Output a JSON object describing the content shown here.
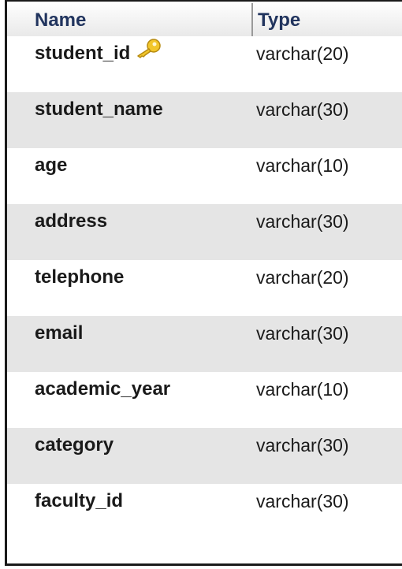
{
  "header": {
    "name_label": "Name",
    "type_label": "Type"
  },
  "rows": [
    {
      "name": "student_id",
      "type": "varchar(20)",
      "primary_key": true,
      "icon": "key-icon"
    },
    {
      "name": "student_name",
      "type": "varchar(30)"
    },
    {
      "name": "age",
      "type": "varchar(10)"
    },
    {
      "name": "address",
      "type": "varchar(30)"
    },
    {
      "name": "telephone",
      "type": "varchar(20)"
    },
    {
      "name": "email",
      "type": "varchar(30)"
    },
    {
      "name": "academic_year",
      "type": "varchar(10)"
    },
    {
      "name": "category",
      "type": "varchar(30)"
    },
    {
      "name": "faculty_id",
      "type": "varchar(30)"
    }
  ],
  "colors": {
    "header_text": "#21345e",
    "row_alt": "#e5e5e5",
    "key_icon": "#f0c020"
  }
}
